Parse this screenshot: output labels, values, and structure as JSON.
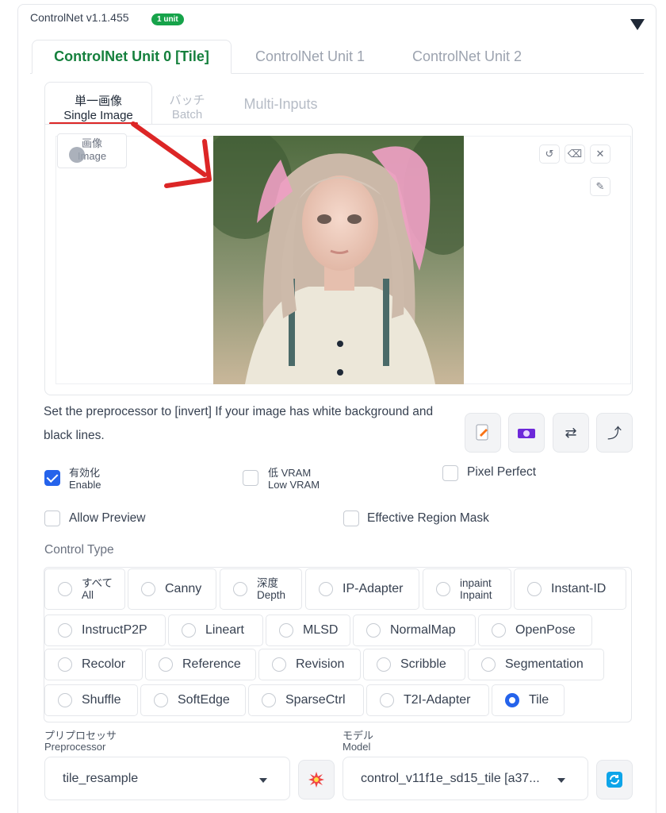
{
  "header": {
    "title": "ControlNet v1.1.455",
    "badge": "1 unit"
  },
  "unit_tabs": [
    {
      "label": "ControlNet Unit 0 [Tile]",
      "active": true
    },
    {
      "label": "ControlNet Unit 1",
      "active": false
    },
    {
      "label": "ControlNet Unit 2",
      "active": false
    }
  ],
  "image_tabs": [
    {
      "jp": "単一画像",
      "en": "Single Image",
      "active": true
    },
    {
      "jp": "バッチ",
      "en": "Batch",
      "active": false
    },
    {
      "jp": "",
      "en": "Multi-Inputs",
      "active": false
    }
  ],
  "image_panel": {
    "label_jp": "画像",
    "label_en": "Image"
  },
  "hint": "Set the preprocessor to [invert] If your image has white background and black lines.",
  "checkboxes": {
    "enable": {
      "jp": "有効化",
      "en": "Enable",
      "checked": true
    },
    "low_vram": {
      "jp": "低 VRAM",
      "en": "Low VRAM",
      "checked": false
    },
    "pixel_perfect": {
      "label": "Pixel Perfect",
      "checked": false
    },
    "allow_preview": {
      "label": "Allow Preview",
      "checked": false
    },
    "effective_region_mask": {
      "label": "Effective Region Mask",
      "checked": false
    }
  },
  "control_type": {
    "label": "Control Type",
    "options": [
      {
        "jp": "すべて",
        "en": "All"
      },
      {
        "label": "Canny"
      },
      {
        "jp": "深度",
        "en": "Depth"
      },
      {
        "label": "IP-Adapter"
      },
      {
        "jp": "inpaint",
        "en": "Inpaint"
      },
      {
        "label": "Instant-ID"
      },
      {
        "label": "InstructP2P"
      },
      {
        "label": "Lineart"
      },
      {
        "label": "MLSD"
      },
      {
        "label": "NormalMap"
      },
      {
        "label": "OpenPose"
      },
      {
        "label": "Recolor"
      },
      {
        "label": "Reference"
      },
      {
        "label": "Revision"
      },
      {
        "label": "Scribble"
      },
      {
        "label": "Segmentation"
      },
      {
        "label": "Shuffle"
      },
      {
        "label": "SoftEdge"
      },
      {
        "label": "SparseCtrl"
      },
      {
        "label": "T2I-Adapter"
      },
      {
        "label": "Tile"
      }
    ],
    "selected": "Tile"
  },
  "preprocessor": {
    "label_jp": "プリプロセッサ",
    "label_en": "Preprocessor",
    "value": "tile_resample"
  },
  "model": {
    "label_jp": "モデル",
    "label_en": "Model",
    "value": "control_v11f1e_sd15_tile [a37..."
  },
  "colors": {
    "accent_green": "#15803d",
    "badge_green": "#16a34a",
    "blue": "#2563eb",
    "annotation_red": "#dc2626"
  }
}
